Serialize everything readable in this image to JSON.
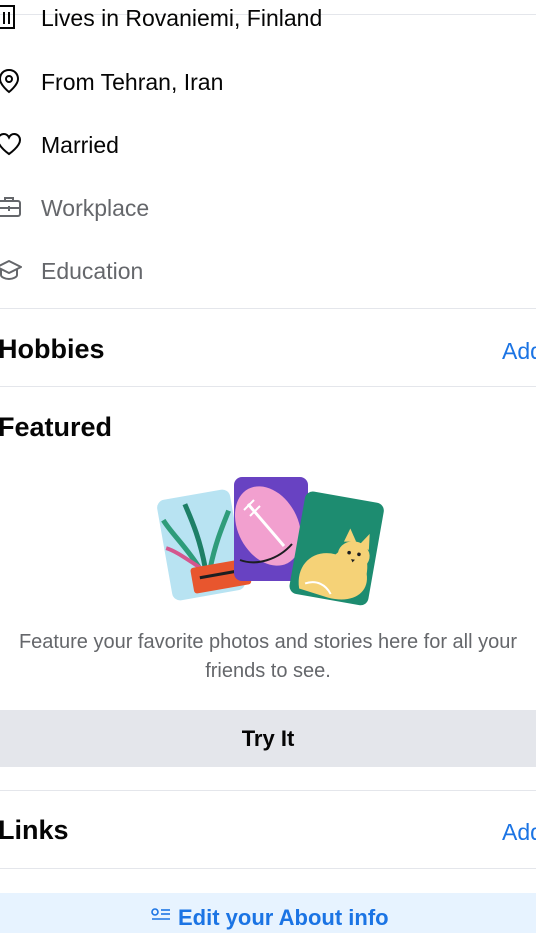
{
  "about": {
    "items": [
      {
        "icon": "building-icon",
        "label": "Lives in Rovaniemi, Finland"
      },
      {
        "icon": "location-pin-icon",
        "label": "From Tehran, Iran"
      },
      {
        "icon": "heart-icon",
        "label": "Married"
      },
      {
        "icon": "briefcase-icon",
        "label": "Workplace"
      },
      {
        "icon": "graduation-cap-icon",
        "label": "Education"
      }
    ]
  },
  "hobbies": {
    "title": "Hobbies",
    "add_label": "Add"
  },
  "featured": {
    "title": "Featured",
    "description": "Feature your favorite photos and stories here for all your friends to see.",
    "button_label": "Try It"
  },
  "links": {
    "title": "Links",
    "add_label": "Add"
  },
  "edit_about": {
    "label": "Edit your About info"
  },
  "colors": {
    "accent": "#1b74e4",
    "muted_text": "#65676b",
    "button_bg": "#e4e6eb",
    "edit_bg": "#e7f3ff"
  }
}
